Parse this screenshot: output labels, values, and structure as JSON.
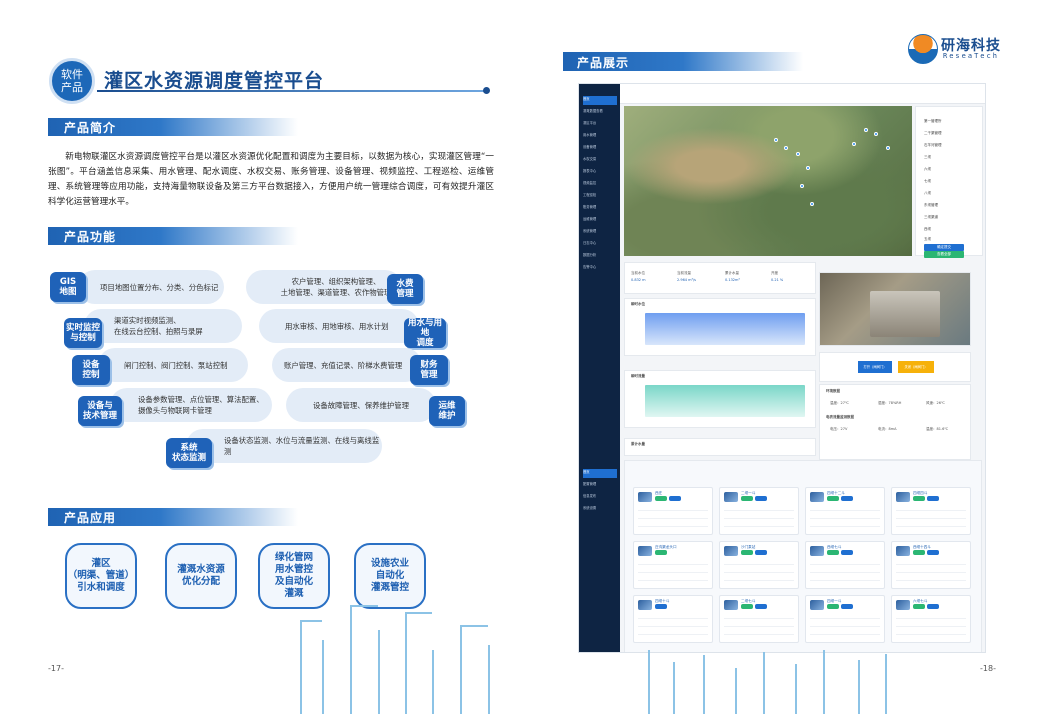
{
  "left": {
    "tag": "软件\n产品",
    "title": "灌区水资源调度管控平台",
    "sections": {
      "intro": "产品简介",
      "functions": "产品功能",
      "applications": "产品应用"
    },
    "intro_text": "新电物联灌区水资源调度管控平台是以灌区水资源优化配置和调度为主要目标，以数据为核心，实现灌区管理“一张图”。平台涵盖信息采集、用水管理、配水调度、水权交易、账务管理、设备管理、视频监控、工程巡检、运维管理、系统管理等应用功能，支持海量物联设备及第三方平台数据接入，方便用户统一管理综合调度，可有效提升灌区科学化运营管理水平。",
    "functions": [
      {
        "badge": "GIS\n地图",
        "desc": "项目地图位置分布、分类、分色标记"
      },
      {
        "badge": "水费\n管理",
        "desc": "农户管理、组织架构管理、\n土地管理、渠道管理、农作物管理"
      },
      {
        "badge": "实时监控\n与控制",
        "desc": "渠道实时视频监测、\n在线云台控制、拍照与录屏"
      },
      {
        "badge": "用水与用地\n调度",
        "desc": "用水审核、用地审核、用水计划"
      },
      {
        "badge": "设备\n控制",
        "desc": "闸门控制、阀门控制、泵站控制"
      },
      {
        "badge": "财务\n管理",
        "desc": "账户管理、充值记录、阶梯水费管理"
      },
      {
        "badge": "设备与\n技术管理",
        "desc": "设备参数管理、点位管理、算法配置、\n摄像头与物联网卡管理"
      },
      {
        "badge": "运维\n维护",
        "desc": "设备故障管理、保养维护管理"
      },
      {
        "badge": "系统\n状态监测",
        "desc": "设备状态监测、水位与流量监测、在线与离线监测"
      }
    ],
    "applications": [
      "灌区\n（明渠、管道）\n引水和调度",
      "灌溉水资源\n优化分配",
      "绿化管网\n用水管控\n及自动化\n灌溉",
      "设施农业\n自动化\n灌溉管控"
    ],
    "page_number": "-17-"
  },
  "right": {
    "logo_cn": "研海科技",
    "logo_en": "ReseaTech",
    "section": "产品展示",
    "page_number": "-18-",
    "screenshot": {
      "sidebar": [
        "首页",
        "灌溉数据查看",
        "灌区平台",
        "用水管理",
        "设备管理",
        "水权交易",
        "报表中心",
        "视频监控",
        "工程巡检",
        "账务管理",
        "运维管理",
        "系统管理",
        "日志中心",
        "数据分析",
        "告警中心",
        "配置管理",
        "信息发布",
        "系统设置"
      ],
      "panel_items": [
        "第一管理所",
        "二干渠管理",
        "石羊河管理",
        "三坝",
        "六坝",
        "七坝",
        "八坝",
        "东坝管理",
        "三坝渠道",
        "西坝",
        "五坝"
      ],
      "panel_btn_blue": "确定提交",
      "panel_btn_green": "查看全部",
      "stat_values": [
        "0.832 m",
        "2.964 m³/s",
        "0.132m³",
        "0.21 %"
      ],
      "stat_labels": [
        "当前水位",
        "当前流量",
        "累计水量",
        "开度"
      ],
      "chart1_title": "瞬时水位",
      "chart2_title": "瞬时流量",
      "chart3_title": "累计水量",
      "btn_open": "打开（闸阀门）",
      "btn_close": "关闭（闸阀门）",
      "env_title": "环境数据",
      "env_values": [
        "温度：27℃",
        "湿度：78%RH",
        "风速：26℃"
      ],
      "meter_title": "电表流量监测数据",
      "meter_values": [
        "电压：27V",
        "电流：8mA",
        "温度：81.6℃"
      ],
      "device_names": [
        "西庄",
        "二坝一斗",
        "四坝十二斗",
        "四坝四斗",
        "庄沟渠龙头口",
        "沙门泵站",
        "西坝七斗",
        "西坝十四斗",
        "四坝十斗",
        "二坝七斗",
        "四坝一斗",
        "六坝七斗"
      ]
    }
  }
}
